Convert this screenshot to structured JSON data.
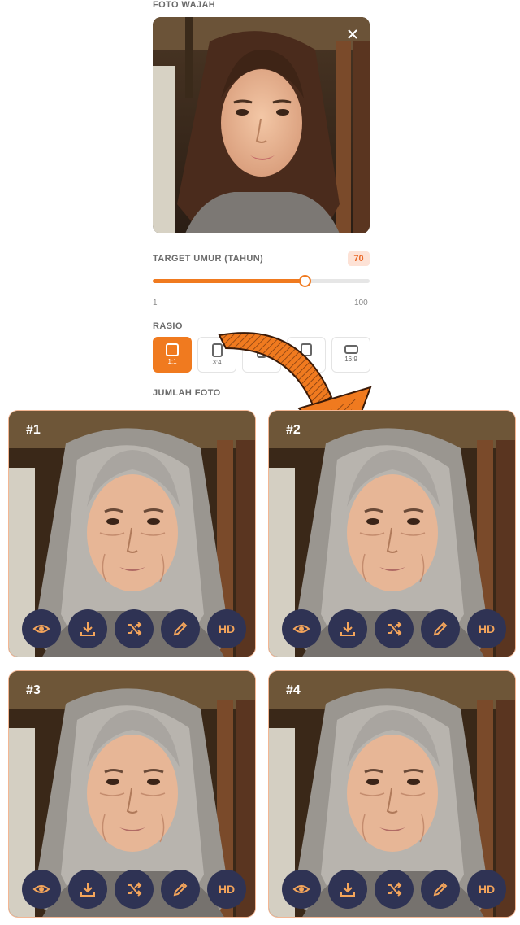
{
  "source": {
    "label": "FOTO WAJAH",
    "close_icon": "close-icon"
  },
  "age": {
    "label": "TARGET UMUR (TAHUN)",
    "value": "70",
    "fraction": 0.7,
    "min": "1",
    "max": "100"
  },
  "ratio": {
    "label": "RASIO",
    "options": [
      {
        "label": "1:1",
        "selected": true
      },
      {
        "label": "3:4",
        "selected": false
      },
      {
        "label": "",
        "selected": false
      },
      {
        "label": "",
        "selected": false
      },
      {
        "label": "16:9",
        "selected": false
      }
    ]
  },
  "count": {
    "label": "JUMLAH FOTO"
  },
  "results": [
    {
      "number": "#1"
    },
    {
      "number": "#2"
    },
    {
      "number": "#3"
    },
    {
      "number": "#4"
    }
  ],
  "actions": {
    "view_icon": "eye-icon",
    "download_icon": "download-icon",
    "shuffle_icon": "shuffle-icon",
    "edit_icon": "pencil-icon",
    "hd_label": "HD"
  },
  "colors": {
    "accent": "#f07a1f",
    "action_bg": "#2f3354",
    "action_fg": "#f4a55b"
  }
}
